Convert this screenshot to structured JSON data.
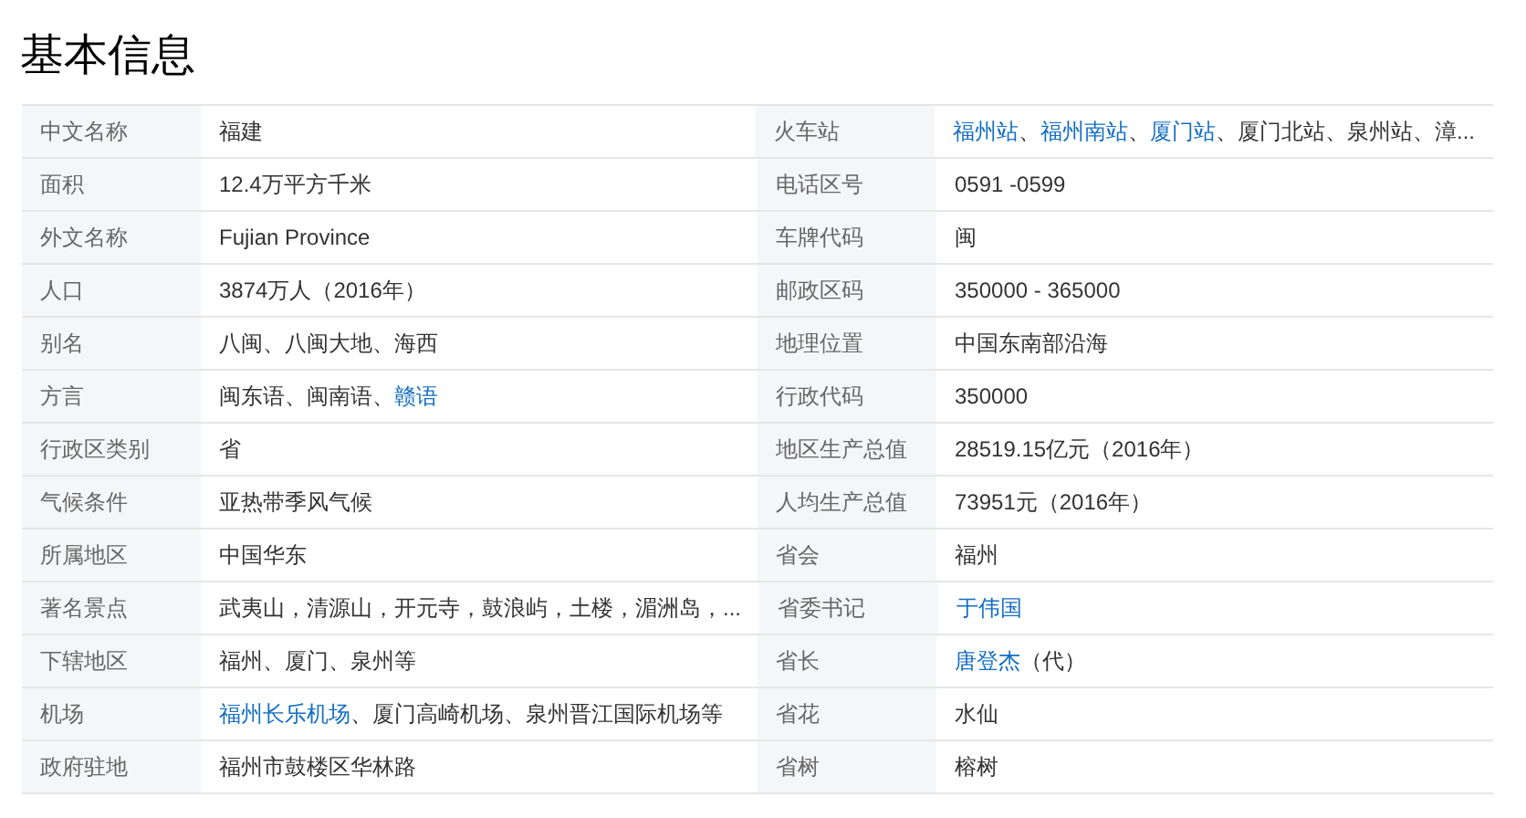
{
  "title": "基本信息",
  "rows": [
    {
      "left": {
        "label": "中文名称",
        "value": [
          {
            "text": "福建",
            "link": false
          }
        ]
      },
      "right": {
        "label": "火车站",
        "value": [
          {
            "text": "福州站",
            "link": true
          },
          {
            "text": "、",
            "link": false
          },
          {
            "text": "福州南站",
            "link": true
          },
          {
            "text": "、",
            "link": false
          },
          {
            "text": "厦门站",
            "link": true
          },
          {
            "text": "、厦门北站、泉州站、漳...",
            "link": false
          }
        ]
      }
    },
    {
      "left": {
        "label": "面积",
        "value": [
          {
            "text": "12.4万平方千米",
            "link": false
          }
        ]
      },
      "right": {
        "label": "电话区号",
        "value": [
          {
            "text": "0591 -0599",
            "link": false
          }
        ]
      }
    },
    {
      "left": {
        "label": "外文名称",
        "value": [
          {
            "text": "Fujian Province",
            "link": false
          }
        ]
      },
      "right": {
        "label": "车牌代码",
        "value": [
          {
            "text": "闽",
            "link": false
          }
        ]
      }
    },
    {
      "left": {
        "label": "人口",
        "value": [
          {
            "text": "3874万人（2016年）",
            "link": false
          }
        ]
      },
      "right": {
        "label": "邮政区码",
        "value": [
          {
            "text": "350000 - 365000",
            "link": false
          }
        ]
      }
    },
    {
      "left": {
        "label": "别名",
        "value": [
          {
            "text": "八闽、八闽大地、海西",
            "link": false
          }
        ]
      },
      "right": {
        "label": "地理位置",
        "value": [
          {
            "text": "中国东南部沿海",
            "link": false
          }
        ]
      }
    },
    {
      "left": {
        "label": "方言",
        "value": [
          {
            "text": "闽东语、闽南语、",
            "link": false
          },
          {
            "text": "赣语",
            "link": true
          }
        ]
      },
      "right": {
        "label": "行政代码",
        "value": [
          {
            "text": "350000",
            "link": false
          }
        ]
      }
    },
    {
      "left": {
        "label": "行政区类别",
        "value": [
          {
            "text": "省",
            "link": false
          }
        ]
      },
      "right": {
        "label": "地区生产总值",
        "value": [
          {
            "text": "28519.15亿元（2016年）",
            "link": false
          }
        ]
      }
    },
    {
      "left": {
        "label": "气候条件",
        "value": [
          {
            "text": "亚热带季风气候",
            "link": false
          }
        ]
      },
      "right": {
        "label": "人均生产总值",
        "value": [
          {
            "text": "73951元（2016年）",
            "link": false
          }
        ]
      }
    },
    {
      "left": {
        "label": "所属地区",
        "value": [
          {
            "text": "中国华东",
            "link": false
          }
        ]
      },
      "right": {
        "label": "省会",
        "value": [
          {
            "text": "福州",
            "link": false
          }
        ]
      }
    },
    {
      "left": {
        "label": "著名景点",
        "value": [
          {
            "text": "武夷山，清源山，开元寺，鼓浪屿，土楼，湄洲岛，...",
            "link": false
          }
        ]
      },
      "right": {
        "label": "省委书记",
        "value": [
          {
            "text": "于伟国",
            "link": true
          }
        ]
      }
    },
    {
      "left": {
        "label": "下辖地区",
        "value": [
          {
            "text": "福州、厦门、泉州等",
            "link": false
          }
        ]
      },
      "right": {
        "label": "省长",
        "value": [
          {
            "text": "唐登杰",
            "link": true
          },
          {
            "text": "（代）",
            "link": false
          }
        ]
      }
    },
    {
      "left": {
        "label": "机场",
        "value": [
          {
            "text": "福州长乐机场",
            "link": true
          },
          {
            "text": "、厦门高崎机场、泉州晋江国际机场等",
            "link": false
          }
        ]
      },
      "right": {
        "label": "省花",
        "value": [
          {
            "text": "水仙",
            "link": false
          }
        ]
      }
    },
    {
      "left": {
        "label": "政府驻地",
        "value": [
          {
            "text": "福州市鼓楼区华林路",
            "link": false
          }
        ]
      },
      "right": {
        "label": "省树",
        "value": [
          {
            "text": "榕树",
            "link": false
          }
        ]
      }
    }
  ]
}
